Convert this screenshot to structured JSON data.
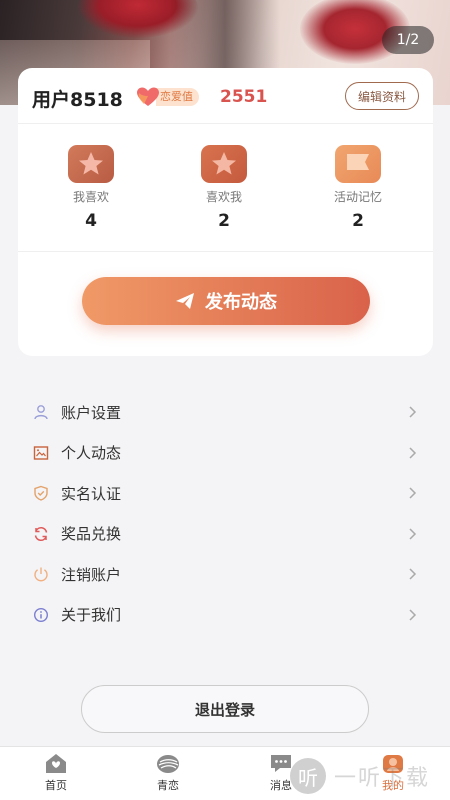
{
  "hero": {
    "pager": "1/2"
  },
  "profile": {
    "username": "用户8518",
    "love_label": "恋爱值",
    "love_score": "2551",
    "edit_label": "编辑资料"
  },
  "stats": [
    {
      "label": "我喜欢",
      "value": "4"
    },
    {
      "label": "喜欢我",
      "value": "2"
    },
    {
      "label": "活动记忆",
      "value": "2"
    }
  ],
  "publish_label": "发布动态",
  "menu": [
    {
      "label": "账户设置",
      "icon": "user-icon"
    },
    {
      "label": "个人动态",
      "icon": "image-icon"
    },
    {
      "label": "实名认证",
      "icon": "shield-icon"
    },
    {
      "label": "奖品兑换",
      "icon": "exchange-icon"
    },
    {
      "label": "注销账户",
      "icon": "power-icon"
    },
    {
      "label": "关于我们",
      "icon": "info-icon"
    }
  ],
  "logout_label": "退出登录",
  "tabs": [
    {
      "label": "首页",
      "icon": "home-icon"
    },
    {
      "label": "青恋",
      "icon": "feather-icon"
    },
    {
      "label": "消息",
      "icon": "chat-icon"
    },
    {
      "label": "我的",
      "icon": "profile-icon"
    }
  ],
  "watermark": {
    "glyph": "听",
    "text": "一听下载"
  },
  "colors": {
    "accent": "#e07a44",
    "score": "#d9534f",
    "publish_start": "#f09a67",
    "publish_end": "#d9624a"
  }
}
